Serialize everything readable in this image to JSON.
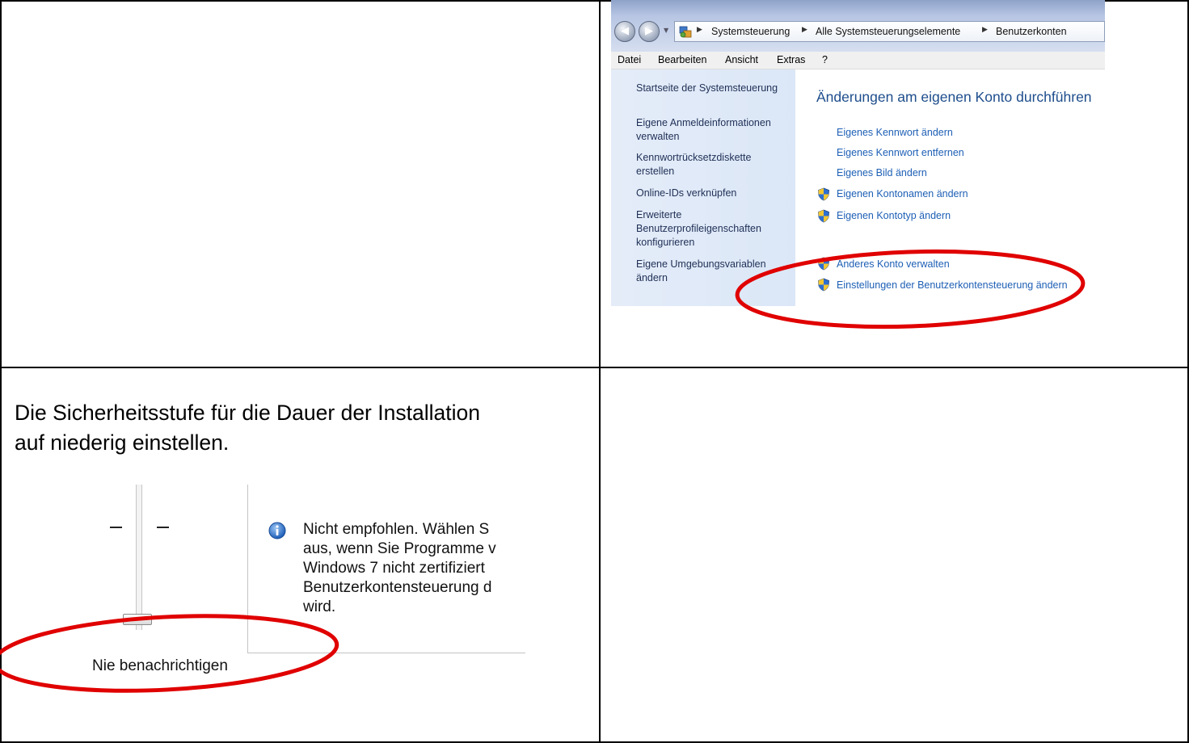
{
  "accent_colors": {
    "annotation": "#e00000",
    "link": "#1d5fb5",
    "heading": "#1e4d8c"
  },
  "control_panel": {
    "breadcrumbs": [
      "Systemsteuerung",
      "Alle Systemsteuerungselemente",
      "Benutzerkonten"
    ],
    "menu": [
      "Datei",
      "Bearbeiten",
      "Ansicht",
      "Extras",
      "?"
    ],
    "left_links": [
      "Startseite der Systemsteuerung",
      "Eigene Anmeldeinformationen verwalten",
      "Kennwortrücksetzdiskette erstellen",
      "Online-IDs verknüpfen",
      "Erweiterte Benutzerprofileigenschaften konfigurieren",
      "Eigene Umgebungsvariablen ändern"
    ],
    "heading": "Änderungen am eigenen Konto durchführen",
    "links": [
      "Eigenes Kennwort ändern",
      "Eigenes Kennwort entfernen",
      "Eigenes Bild ändern",
      "Eigenen Kontonamen ändern",
      "Eigenen Kontotyp ändern",
      "Anderes Konto verwalten",
      "Einstellungen der Benutzerkontensteuerung ändern"
    ],
    "icons": {
      "nav_back": "back-arrow-icon",
      "nav_forward": "forward-arrow-icon",
      "shield": "uac-shield-icon",
      "control_panel": "control-panel-icon"
    }
  },
  "instruction": {
    "line1": "Die Sicherheitsstufe für die Dauer der Installation",
    "line2": "auf niederig einstellen."
  },
  "uac": {
    "slider_label": "Nie benachrichtigen",
    "slider_level": 0,
    "info_lines": [
      "Nicht empfohlen. Wählen S",
      "aus, wenn Sie Programme v",
      "Windows 7 nicht zertifiziert",
      "Benutzerkontensteuerung d",
      "wird."
    ],
    "icons": {
      "info": "info-icon"
    }
  }
}
